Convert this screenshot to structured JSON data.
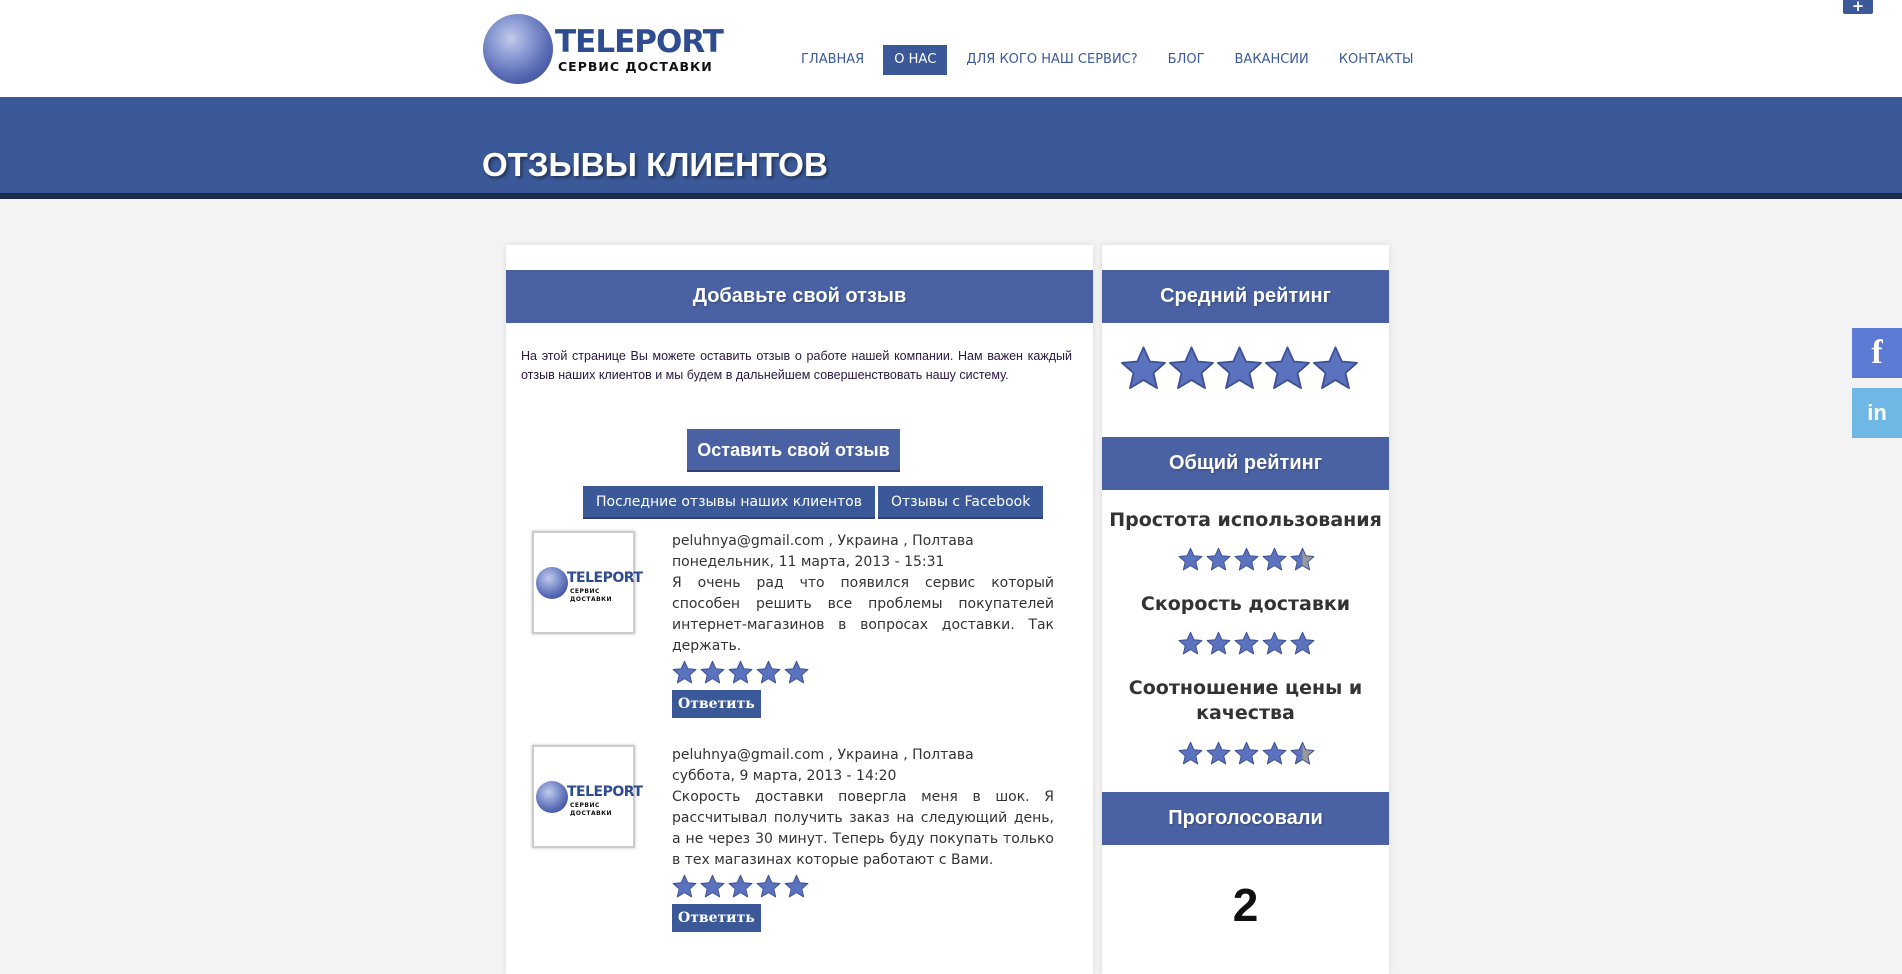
{
  "logo": {
    "title": "TELEPORT",
    "subtitle": "СЕРВИС ДОСТАВКИ"
  },
  "nav": {
    "items": [
      {
        "label": "ГЛАВНАЯ",
        "active": false
      },
      {
        "label": "О НАС",
        "active": true
      },
      {
        "label": "ДЛЯ КОГО НАШ СЕРВИС?",
        "active": false
      },
      {
        "label": "БЛОГ",
        "active": false
      },
      {
        "label": "ВАКАНСИИ",
        "active": false
      },
      {
        "label": "КОНТАКТЫ",
        "active": false
      }
    ]
  },
  "top_corner": {
    "plus_label": "+"
  },
  "banner": {
    "title": "ОТЗЫВЫ КЛИЕНТОВ"
  },
  "social": {
    "facebook_label": "f",
    "linkedin_label": "in"
  },
  "main": {
    "heading": "Добавьте свой отзыв",
    "intro": "На этой странице Вы можете оставить отзыв о работе нашей компании. Нам важен каждый отзыв наших клиентов и мы будем в дальнейшем совершенствовать нашу систему.",
    "leave_button": "Оставить свой отзыв",
    "tabs": [
      "Последние отзывы наших клиентов",
      "Отзывы с Facebook"
    ],
    "reviews": [
      {
        "author": "peluhnya@gmail.com , Украина , Полтава",
        "date": "понедельник, 11 марта, 2013 - 15:31",
        "text": "Я очень рад что появился сервис который способен решить все проблемы покупателей интернет-магазинов в вопросах доставки. Так держать.",
        "rating": 5,
        "reply_label": "Ответить"
      },
      {
        "author": "peluhnya@gmail.com , Украина , Полтава",
        "date": "суббота, 9 марта, 2013 - 14:20",
        "text": "Скорость доставки повергла меня в шок. Я рассчитывал получить заказ на следующий день, а не через 30 минут. Теперь буду покупать только в тех магазинах которые работают с Вами.",
        "rating": 5,
        "reply_label": "Ответить"
      }
    ]
  },
  "sidebar": {
    "avg_heading": "Средний рейтинг",
    "avg_rating": 5,
    "overall_heading": "Общий рейтинг",
    "criteria": [
      {
        "label": "Простота использования",
        "rating": 4.5
      },
      {
        "label": "Скорость доставки",
        "rating": 5
      },
      {
        "label": "Соотношение цены и качества",
        "rating": 4.5
      }
    ],
    "voted_heading": "Проголосовали",
    "voted_count": "2"
  },
  "colors": {
    "brand": "#3b5998",
    "box_head": "#4a62a3",
    "star": "#5b72bf",
    "star_empty": "#9a9a9a"
  },
  "icons": {
    "rating_star": "star-icon",
    "avatar": "teleport-logo-icon",
    "facebook": "facebook-icon",
    "linkedin": "linkedin-icon",
    "plus": "plus-icon"
  }
}
